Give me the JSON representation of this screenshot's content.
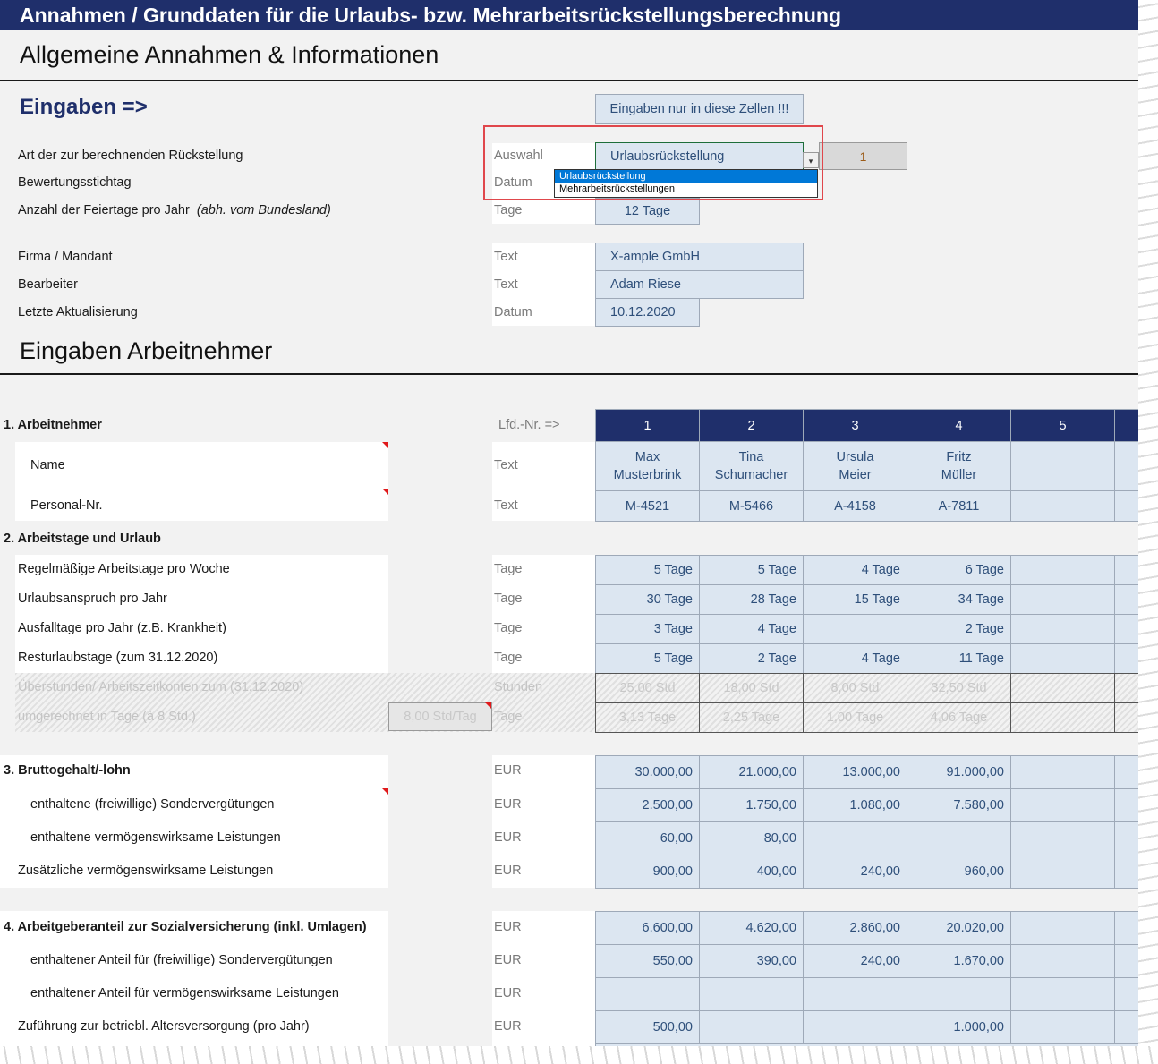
{
  "banner_title": "Annahmen / Grunddaten für die Urlaubs- bzw. Mehrarbeitsrückstellungsberechnung",
  "general": {
    "title": "Allgemeine Annahmen & Informationen",
    "eingaben_label": "Eingaben =>",
    "hint_button": "Eingaben nur in diese Zellen !!!",
    "rows": {
      "art": {
        "label": "Art der zur berechnenden Rückstellung",
        "unit": "Auswahl",
        "value": "Urlaubsrückstellung",
        "index": "1"
      },
      "stichtag": {
        "label": "Bewertungsstichtag",
        "unit": "Datum"
      },
      "feiertage": {
        "label": "Anzahl der Feiertage pro Jahr",
        "note": "(abh. vom Bundesland)",
        "unit": "Tage",
        "value": "12 Tage"
      },
      "firma": {
        "label": "Firma / Mandant",
        "unit": "Text",
        "value": "X-ample GmbH"
      },
      "bearbeiter": {
        "label": "Bearbeiter",
        "unit": "Text",
        "value": "Adam Riese"
      },
      "aktualisierung": {
        "label": "Letzte Aktualisierung",
        "unit": "Datum",
        "value": "10.12.2020"
      }
    },
    "dropdown_options": [
      "Urlaubsrückstellung",
      "Mehrarbeitsrückstellungen"
    ]
  },
  "employees": {
    "title": "Eingaben Arbeitnehmer",
    "lfd_label": "Lfd.-Nr. =>",
    "numbers": [
      "1",
      "2",
      "3",
      "4",
      "5"
    ],
    "s1": {
      "title": "1. Arbeitnehmer",
      "name": {
        "label": "Name",
        "unit": "Text",
        "first": [
          "Max",
          "Tina",
          "Ursula",
          "Fritz",
          ""
        ],
        "last": [
          "Musterbrink",
          "Schumacher",
          "Meier",
          "Müller",
          ""
        ]
      },
      "pnr": {
        "label": "Personal-Nr.",
        "unit": "Text",
        "values": [
          "M-4521",
          "M-5466",
          "A-4158",
          "A-7811",
          ""
        ]
      }
    },
    "s2": {
      "title": "2. Arbeitstage und Urlaub",
      "rows": [
        {
          "label": "Regelmäßige Arbeitstage pro Woche",
          "unit": "Tage",
          "values": [
            "5 Tage",
            "5 Tage",
            "4 Tage",
            "6 Tage",
            ""
          ]
        },
        {
          "label": "Urlaubsanspruch pro Jahr",
          "unit": "Tage",
          "values": [
            "30 Tage",
            "28 Tage",
            "15 Tage",
            "34 Tage",
            ""
          ]
        },
        {
          "label": "Ausfalltage pro Jahr (z.B. Krankheit)",
          "unit": "Tage",
          "values": [
            "3 Tage",
            "4 Tage",
            "",
            "2 Tage",
            ""
          ]
        },
        {
          "label": "Resturlaubstage (zum 31.12.2020)",
          "unit": "Tage",
          "values": [
            "5 Tage",
            "2 Tage",
            "4 Tage",
            "11 Tage",
            ""
          ]
        }
      ],
      "greyed": [
        {
          "label": "Überstunden/ Arbeitszeitkonten zum (31.12.2020)",
          "unit": "Stunden",
          "values": [
            "25,00 Std",
            "18,00 Std",
            "8,00 Std",
            "32,50 Std",
            ""
          ]
        },
        {
          "label": "umgerechnet in Tage (à 8 Std.)",
          "unit": "Tage",
          "factor": "8,00 Std/Tag",
          "values": [
            "3,13 Tage",
            "2,25 Tage",
            "1,00 Tage",
            "4,06 Tage",
            ""
          ]
        }
      ]
    },
    "s3": {
      "title": "3. Bruttogehalt/-lohn",
      "unit": "EUR",
      "title_values": [
        "30.000,00",
        "21.000,00",
        "13.000,00",
        "91.000,00",
        ""
      ],
      "rows": [
        {
          "label": "enthaltene (freiwillige) Sondervergütungen",
          "unit": "EUR",
          "values": [
            "2.500,00",
            "1.750,00",
            "1.080,00",
            "7.580,00",
            ""
          ]
        },
        {
          "label": "enthaltene vermögenswirksame Leistungen",
          "unit": "EUR",
          "values": [
            "60,00",
            "80,00",
            "",
            "",
            ""
          ]
        },
        {
          "label": "Zusätzliche vermögenswirksame Leistungen",
          "unit": "EUR",
          "values": [
            "900,00",
            "400,00",
            "240,00",
            "960,00",
            ""
          ]
        }
      ]
    },
    "s4": {
      "title": "4. Arbeitgeberanteil zur Sozialversicherung (inkl. Umlagen)",
      "unit": "EUR",
      "title_values": [
        "6.600,00",
        "4.620,00",
        "2.860,00",
        "20.020,00",
        ""
      ],
      "rows": [
        {
          "label": "enthaltener Anteil für (freiwillige) Sondervergütungen",
          "unit": "EUR",
          "values": [
            "550,00",
            "390,00",
            "240,00",
            "1.670,00",
            ""
          ]
        },
        {
          "label": "enthaltener Anteil für vermögenswirksame Leistungen",
          "unit": "EUR",
          "values": [
            "",
            "",
            "",
            "",
            ""
          ]
        },
        {
          "label": "Zuführung zur betriebl. Altersversorgung (pro Jahr)",
          "unit": "EUR",
          "values": [
            "500,00",
            "",
            "",
            "1.000,00",
            ""
          ]
        }
      ]
    }
  }
}
